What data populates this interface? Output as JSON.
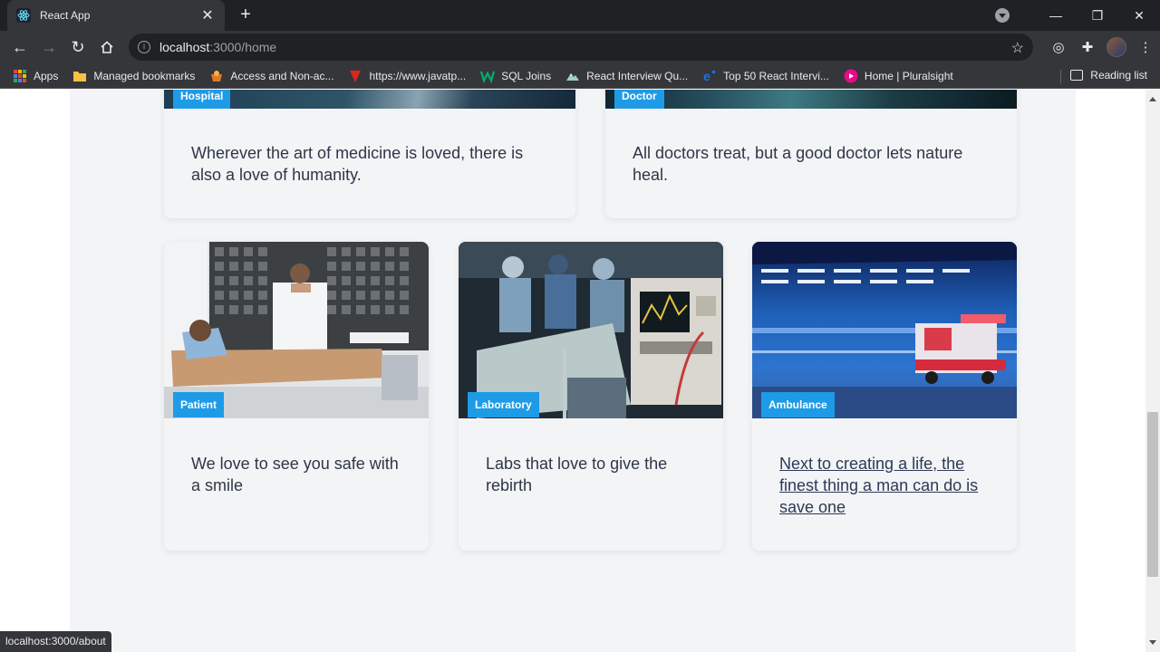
{
  "browser": {
    "tab_title": "React App",
    "url_host": "localhost",
    "url_path": ":3000/home"
  },
  "bookmarks": {
    "items": [
      {
        "label": "Apps",
        "icon": "apps-grid-icon"
      },
      {
        "label": "Managed bookmarks",
        "icon": "folder-icon"
      },
      {
        "label": "Access and Non-ac...",
        "icon": "tool-icon"
      },
      {
        "label": "https://www.javatp...",
        "icon": "javatpoint-icon"
      },
      {
        "label": "SQL Joins",
        "icon": "w3-icon"
      },
      {
        "label": "React Interview Qu...",
        "icon": "mountain-icon"
      },
      {
        "label": "Top 50 React Intervi...",
        "icon": "edureka-icon"
      },
      {
        "label": "Home | Pluralsight",
        "icon": "pluralsight-icon"
      }
    ],
    "reading_list": "Reading list"
  },
  "cards": [
    {
      "tag": "Hospital",
      "text": "Wherever the art of medicine is loved, there is also a love of humanity."
    },
    {
      "tag": "Doctor",
      "text": "All doctors treat, but a good doctor lets nature heal."
    },
    {
      "tag": "Patient",
      "text": "We love to see you safe with a smile"
    },
    {
      "tag": "Laboratory",
      "text": "Labs that love to give the rebirth"
    },
    {
      "tag": "Ambulance",
      "text": "Next to creating a life, the finest thing a man can do is save one"
    }
  ],
  "status_bar": "localhost:3000/about",
  "colors": {
    "badge": "#1e9be6",
    "page_bg": "#f3f4f6",
    "text": "#2d3748"
  }
}
